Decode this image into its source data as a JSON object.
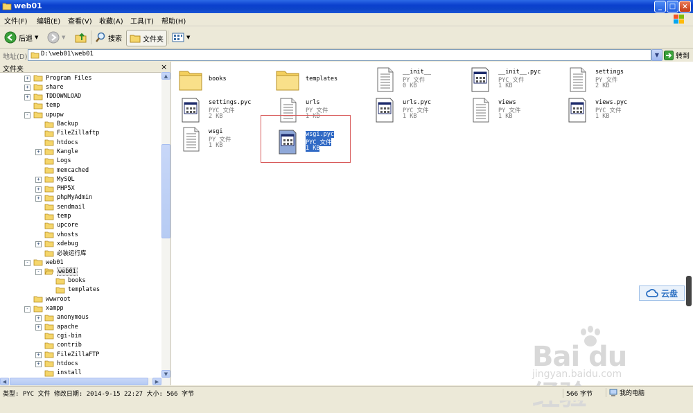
{
  "window": {
    "title": "web01"
  },
  "menu": [
    "文件(F)",
    "编辑(E)",
    "查看(V)",
    "收藏(A)",
    "工具(T)",
    "帮助(H)"
  ],
  "toolbar": {
    "back": "后退",
    "search": "搜索",
    "folders": "文件夹"
  },
  "address": {
    "label": "地址(D)",
    "value": "D:\\web01\\web01",
    "go": "转到"
  },
  "folder_pane": {
    "title": "文件夹",
    "tree": [
      {
        "label": "Program Files",
        "level": 2,
        "expander": "+"
      },
      {
        "label": "share",
        "level": 2,
        "expander": "+"
      },
      {
        "label": "TDDOWNLOAD",
        "level": 2,
        "expander": "+"
      },
      {
        "label": "temp",
        "level": 2,
        "expander": ""
      },
      {
        "label": "upupw",
        "level": 2,
        "expander": "-"
      },
      {
        "label": "Backup",
        "level": 3,
        "expander": ""
      },
      {
        "label": "FileZillaftp",
        "level": 3,
        "expander": ""
      },
      {
        "label": "htdocs",
        "level": 3,
        "expander": ""
      },
      {
        "label": "Kangle",
        "level": 3,
        "expander": "+"
      },
      {
        "label": "Logs",
        "level": 3,
        "expander": ""
      },
      {
        "label": "memcached",
        "level": 3,
        "expander": ""
      },
      {
        "label": "MySQL",
        "level": 3,
        "expander": "+"
      },
      {
        "label": "PHP5X",
        "level": 3,
        "expander": "+"
      },
      {
        "label": "phpMyAdmin",
        "level": 3,
        "expander": "+"
      },
      {
        "label": "sendmail",
        "level": 3,
        "expander": ""
      },
      {
        "label": "temp",
        "level": 3,
        "expander": ""
      },
      {
        "label": "upcore",
        "level": 3,
        "expander": ""
      },
      {
        "label": "vhosts",
        "level": 3,
        "expander": ""
      },
      {
        "label": "xdebug",
        "level": 3,
        "expander": "+"
      },
      {
        "label": "必装运行库",
        "level": 3,
        "expander": ""
      },
      {
        "label": "web01",
        "level": 2,
        "expander": "-"
      },
      {
        "label": "web01",
        "level": 3,
        "expander": "-",
        "selected": true,
        "open": true
      },
      {
        "label": "books",
        "level": 4,
        "expander": ""
      },
      {
        "label": "templates",
        "level": 4,
        "expander": ""
      },
      {
        "label": "wwwroot",
        "level": 2,
        "expander": ""
      },
      {
        "label": "xampp",
        "level": 2,
        "expander": "-"
      },
      {
        "label": "anonymous",
        "level": 3,
        "expander": "+"
      },
      {
        "label": "apache",
        "level": 3,
        "expander": "+"
      },
      {
        "label": "cgi-bin",
        "level": 3,
        "expander": ""
      },
      {
        "label": "contrib",
        "level": 3,
        "expander": ""
      },
      {
        "label": "FileZillaFTP",
        "level": 3,
        "expander": "+"
      },
      {
        "label": "htdocs",
        "level": 3,
        "expander": "+"
      },
      {
        "label": "install",
        "level": 3,
        "expander": ""
      }
    ]
  },
  "files": [
    {
      "name": "books",
      "kind": "folder"
    },
    {
      "name": "templates",
      "kind": "folder"
    },
    {
      "name": "__init__",
      "kind": "py",
      "type": "PY 文件",
      "size": "0 KB"
    },
    {
      "name": "__init__.pyc",
      "kind": "pyc",
      "type": "PYC 文件",
      "size": "1 KB"
    },
    {
      "name": "settings",
      "kind": "py",
      "type": "PY 文件",
      "size": "2 KB"
    },
    {
      "name": "settings.pyc",
      "kind": "pyc",
      "type": "PYC 文件",
      "size": "2 KB"
    },
    {
      "name": "urls",
      "kind": "py",
      "type": "PY 文件",
      "size": "1 KB"
    },
    {
      "name": "urls.pyc",
      "kind": "pyc",
      "type": "PYC 文件",
      "size": "1 KB"
    },
    {
      "name": "views",
      "kind": "py",
      "type": "PY 文件",
      "size": "1 KB"
    },
    {
      "name": "views.pyc",
      "kind": "pyc",
      "type": "PYC 文件",
      "size": "1 KB"
    },
    {
      "name": "wsgi",
      "kind": "py",
      "type": "PY 文件",
      "size": "1 KB"
    },
    {
      "name": "wsgi.pyc",
      "kind": "pyc",
      "type": "PYC 文件",
      "size": "1 KB",
      "selected": true
    }
  ],
  "status": {
    "info": "类型: PYC 文件 修改日期: 2014-9-15 22:27 大小: 566 字节",
    "size": "566 字节",
    "zone": "我的电脑"
  },
  "overlay": {
    "cloud": "云盘"
  },
  "colors": {
    "title": "#0a3fcd",
    "selection": "#316ac5",
    "highlight_box": "#d85a5a"
  }
}
